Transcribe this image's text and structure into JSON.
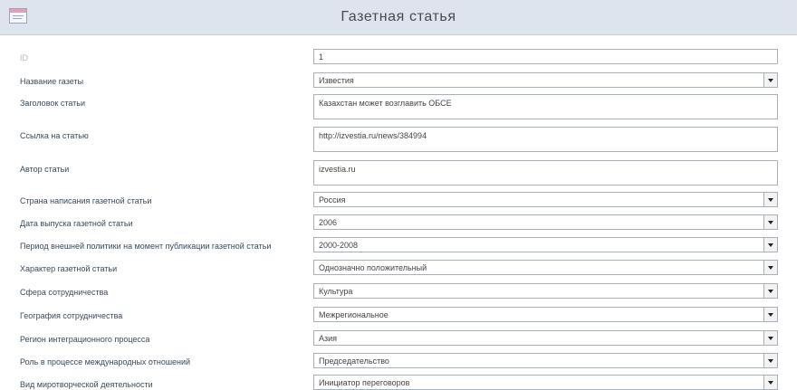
{
  "form": {
    "title": "Газетная статья",
    "icon": "form-icon"
  },
  "fields": {
    "id": {
      "label": "ID",
      "value": "1"
    },
    "newspaper": {
      "label": "Название газеты",
      "value": "Известия"
    },
    "headline": {
      "label": "Заголовок статьи",
      "value": "Казахстан может возглавить ОБСЕ"
    },
    "link": {
      "label": "Ссылка на статью",
      "value": "http://izvestia.ru/news/384994"
    },
    "author": {
      "label": "Автор статьи",
      "value": "izvestia.ru"
    },
    "country": {
      "label": "Страна написания газетной статьи",
      "value": "Россия"
    },
    "date": {
      "label": "Дата выпуска газетной статьи",
      "value": "2006"
    },
    "period": {
      "label": "Период внешней политики на момент публикации газетной статьи",
      "value": "2000-2008"
    },
    "character": {
      "label": "Характер газетной статьи",
      "value": "Однозначно положительный"
    },
    "sphere": {
      "label": "Сфера сотрудничества",
      "value": "Культура"
    },
    "geography": {
      "label": "География сотрудничества",
      "value": "Межрегиональное"
    },
    "region": {
      "label": "Регион интеграционного процесса",
      "value": "Азия"
    },
    "role": {
      "label": "Роль в процессе международных отношений",
      "value": "Председательство"
    },
    "peacekeeping": {
      "label": "Вид миротворческой деятельности",
      "value": "Инициатор переговоров"
    }
  }
}
